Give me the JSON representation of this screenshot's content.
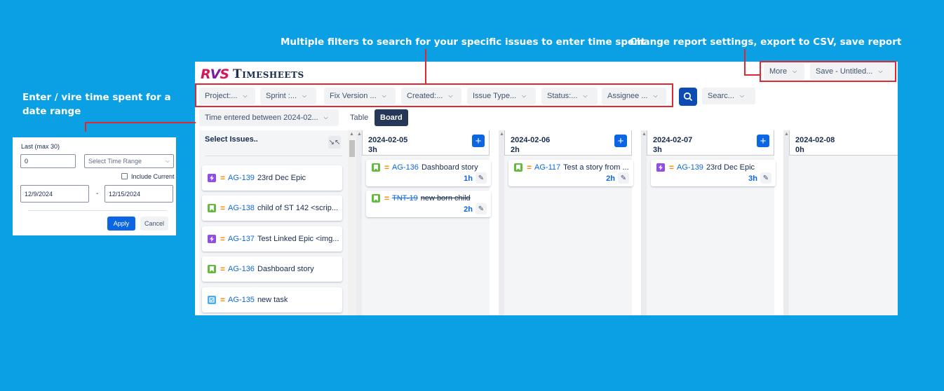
{
  "annotations": {
    "filters": "Multiple filters to search for your specific issues to enter time spent",
    "settings": "Change report settings, export to CSV, save report",
    "date_range_line1": "Enter / vire time spent for a",
    "date_range_line2": "date range"
  },
  "app": {
    "logo_text": "RVS",
    "title": "Timesheets",
    "more_label": "More",
    "save_label": "Save - Untitled..."
  },
  "filters": [
    {
      "label": "Project:..."
    },
    {
      "label": "Sprint :..."
    },
    {
      "label": "Fix Version ..."
    },
    {
      "label": "Created:..."
    },
    {
      "label": "Issue Type..."
    },
    {
      "label": "Status:..."
    },
    {
      "label": "Assignee ..."
    }
  ],
  "search_label": "Searc...",
  "time_range_label": "Time entered between 2024-02...",
  "view": {
    "table": "Table",
    "board": "Board",
    "active": "Board"
  },
  "issues_panel": {
    "title": "Select Issues..",
    "items": [
      {
        "type": "epic",
        "key": "AG-139",
        "summary": "23rd Dec Epic"
      },
      {
        "type": "story",
        "key": "AG-138",
        "summary": "child of ST 142 <scrip..."
      },
      {
        "type": "epic",
        "key": "AG-137",
        "summary": "Test Linked Epic <img..."
      },
      {
        "type": "story",
        "key": "AG-136",
        "summary": "Dashboard story"
      },
      {
        "type": "task",
        "key": "AG-135",
        "summary": "new task"
      }
    ]
  },
  "columns": [
    {
      "date": "2024-02-05",
      "hours": "3h",
      "cards": [
        {
          "type": "story",
          "key": "AG-136",
          "summary": "Dashboard story",
          "hours": "1h",
          "done": false
        },
        {
          "type": "story",
          "key": "TNT-19",
          "summary": "new born child",
          "hours": "2h",
          "done": true
        }
      ]
    },
    {
      "date": "2024-02-06",
      "hours": "2h",
      "cards": [
        {
          "type": "story",
          "key": "AG-117",
          "summary": "Test a story from ...",
          "hours": "2h",
          "done": false
        }
      ]
    },
    {
      "date": "2024-02-07",
      "hours": "3h",
      "cards": [
        {
          "type": "epic",
          "key": "AG-139",
          "summary": "23rd Dec Epic",
          "hours": "3h",
          "done": false
        }
      ]
    },
    {
      "date": "2024-02-08",
      "hours": "0h",
      "cards": []
    }
  ],
  "date_popup": {
    "last_label": "Last (max 30)",
    "last_value": "0",
    "range_placeholder": "Select Time Range",
    "include_current": "Include Current",
    "start_date": "12/9/2024",
    "separator": "-",
    "end_date": "12/15/2024",
    "apply": "Apply",
    "cancel": "Cancel"
  },
  "colors": {
    "background": "#0aa0e3",
    "annotation_red": "#e02834",
    "primary": "#0c66e4",
    "epic": "#904ee2",
    "story": "#63ba3c",
    "task": "#4bade8",
    "priority": "#ff8b00"
  }
}
